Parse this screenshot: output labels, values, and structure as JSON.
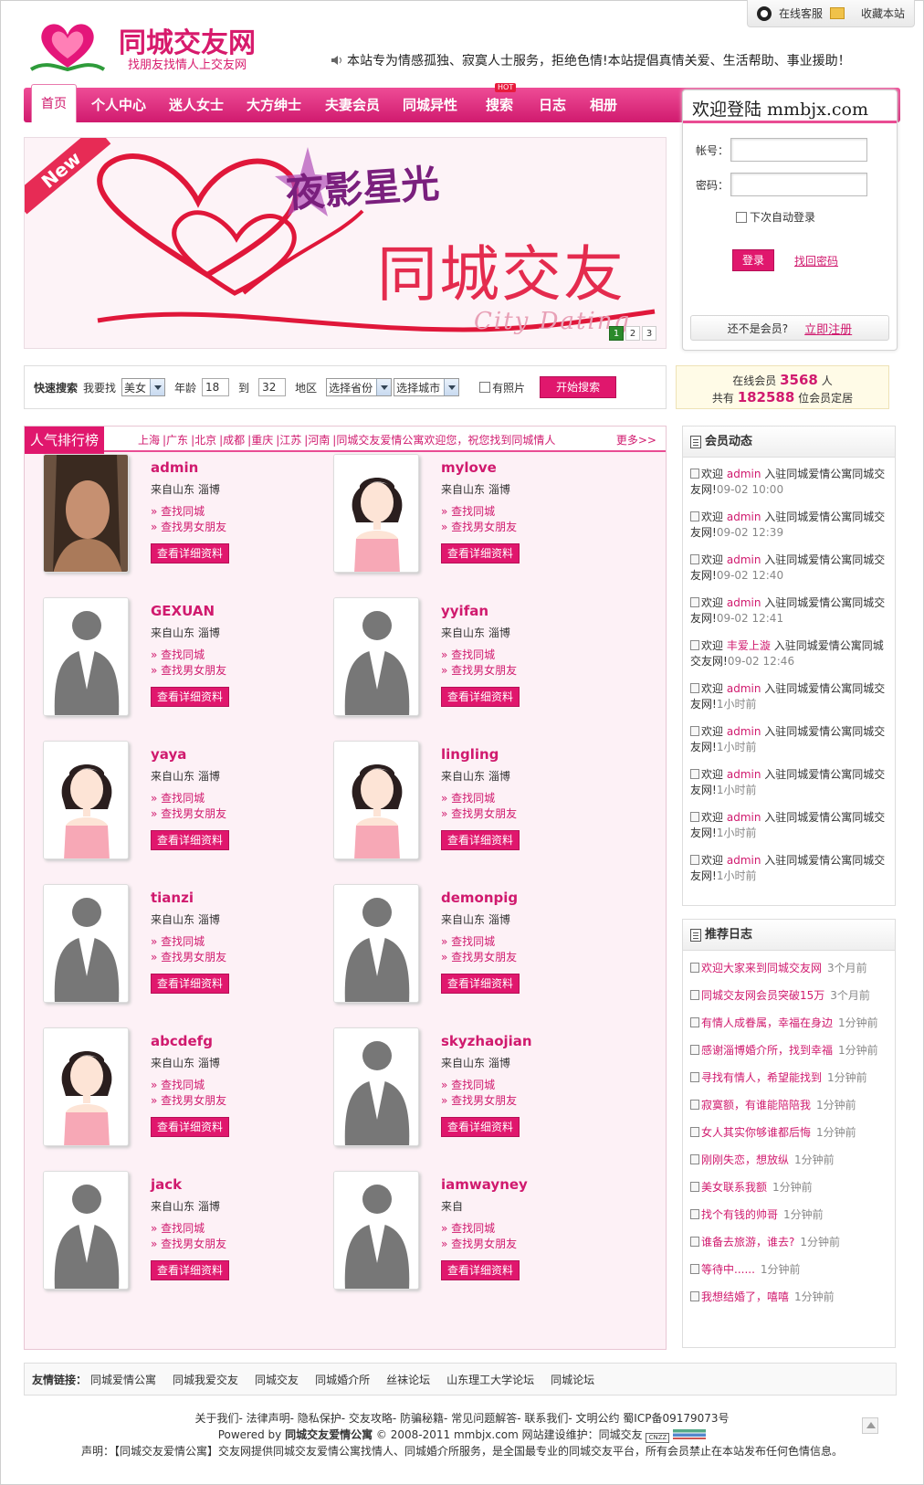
{
  "topbar": {
    "service": "在线客服",
    "bookmark": "收藏本站"
  },
  "logo": {
    "title": "同城交友网",
    "subtitle": "找朋友找情人上交友网"
  },
  "notice": "本站专为情感孤独、寂寞人士服务，拒绝色情!本站提倡真情关爱、生活帮助、事业援助！",
  "nav": {
    "items": [
      "首页",
      "个人中心",
      "迷人女士",
      "大方绅士",
      "夫妻会员",
      "同城异性",
      "搜索",
      "日志",
      "相册"
    ],
    "hot_badge": "HOT"
  },
  "banner": {
    "new_tag": "New",
    "title": "同城交友",
    "subtitle": "夜影星光",
    "english": "City Dating",
    "pages": [
      "1",
      "2",
      "3"
    ]
  },
  "login": {
    "heading": "欢迎登陆 mmbjx.com",
    "account_label": "帐号：",
    "password_label": "密码：",
    "auto_login": "下次自动登录",
    "login_button": "登录",
    "forgot_link": "找回密码",
    "not_member": "还不是会员?",
    "register_link": "立即注册"
  },
  "search": {
    "title": "快速搜索",
    "seek_label": "我要找",
    "gender": "美女",
    "age_label": "年龄",
    "age_from": "18",
    "to_label": "到",
    "age_to": "32",
    "region_label": "地区",
    "province": "选择省份",
    "city": "选择城市",
    "has_photo": "有照片",
    "button": "开始搜索"
  },
  "stats": {
    "online_prefix": "在线会员",
    "online_count": "3568",
    "online_suffix": "人",
    "total_prefix": "共有",
    "total_count": "182588",
    "total_suffix": "位会员定居"
  },
  "popular": {
    "title": "人气排行榜",
    "cities": [
      "上海",
      "|广东",
      "|北京",
      "|成都",
      "|重庆",
      "|江苏",
      "|河南",
      "|同城交友爱情公寓欢迎您，祝您找到同城情人"
    ],
    "more": "更多>>",
    "link1": "查找同城",
    "link2": "查找男女朋友",
    "detail_button": "查看详细资料",
    "members": [
      {
        "name": "admin",
        "from": "来自山东  淄博",
        "photo": "photo"
      },
      {
        "name": "mylove",
        "from": "来自山东  淄博",
        "photo": "cartoon"
      },
      {
        "name": "GEXUAN",
        "from": "来自山东  淄博",
        "photo": "silhouette"
      },
      {
        "name": "yyifan",
        "from": "来自山东  淄博",
        "photo": "silhouette"
      },
      {
        "name": "yaya",
        "from": "来自山东  淄博",
        "photo": "cartoon"
      },
      {
        "name": "lingling",
        "from": "来自山东  淄博",
        "photo": "cartoon"
      },
      {
        "name": "tianzi",
        "from": "来自山东  淄博",
        "photo": "silhouette"
      },
      {
        "name": "demonpig",
        "from": "来自山东  淄博",
        "photo": "silhouette"
      },
      {
        "name": "abcdefg",
        "from": "来自山东  淄博",
        "photo": "cartoon"
      },
      {
        "name": "skyzhaojian",
        "from": "来自山东  淄博",
        "photo": "silhouette"
      },
      {
        "name": "jack",
        "from": "来自山东  淄博",
        "photo": "silhouette"
      },
      {
        "name": "iamwayney",
        "from": "来自",
        "photo": "silhouette"
      }
    ]
  },
  "activity": {
    "title": "会员动态",
    "items": [
      {
        "pre": "欢迎",
        "user": "admin",
        "post": "入驻同城爱情公寓同城交友网!",
        "time": "09-02 10:00"
      },
      {
        "pre": "欢迎",
        "user": "admin",
        "post": "入驻同城爱情公寓同城交友网!",
        "time": "09-02 12:39"
      },
      {
        "pre": "欢迎",
        "user": "admin",
        "post": "入驻同城爱情公寓同城交友网!",
        "time": "09-02 12:40"
      },
      {
        "pre": "欢迎",
        "user": "admin",
        "post": "入驻同城爱情公寓同城交友网!",
        "time": "09-02 12:41"
      },
      {
        "pre": "欢迎",
        "user": "丰爱上漩",
        "post": "入驻同城爱情公寓同城交友网!",
        "time": "09-02 12:46"
      },
      {
        "pre": "欢迎",
        "user": "admin",
        "post": "入驻同城爱情公寓同城交友网!",
        "time": "1小时前"
      },
      {
        "pre": "欢迎",
        "user": "admin",
        "post": "入驻同城爱情公寓同城交友网!",
        "time": "1小时前"
      },
      {
        "pre": "欢迎",
        "user": "admin",
        "post": "入驻同城爱情公寓同城交友网!",
        "time": "1小时前"
      },
      {
        "pre": "欢迎",
        "user": "admin",
        "post": "入驻同城爱情公寓同城交友网!",
        "time": "1小时前"
      },
      {
        "pre": "欢迎",
        "user": "admin",
        "post": "入驻同城爱情公寓同城交友网!",
        "time": "1小时前"
      }
    ]
  },
  "blogs": {
    "title": "推荐日志",
    "items": [
      {
        "title": "欢迎大家来到同城交友网",
        "time": "3个月前"
      },
      {
        "title": "同城交友网会员突破15万",
        "time": "3个月前"
      },
      {
        "title": "有情人成眷属，幸福在身边",
        "time": "1分钟前"
      },
      {
        "title": "感谢淄博婚介所，找到幸福",
        "time": "1分钟前"
      },
      {
        "title": "寻找有情人，希望能找到",
        "time": "1分钟前"
      },
      {
        "title": "寂寞额，有谁能陪陪我",
        "time": "1分钟前"
      },
      {
        "title": "女人其实你够谁都后悔",
        "time": "1分钟前"
      },
      {
        "title": "刚刚失恋，想放纵",
        "time": "1分钟前"
      },
      {
        "title": "美女联系我额",
        "time": "1分钟前"
      },
      {
        "title": "找个有钱的帅哥",
        "time": "1分钟前"
      },
      {
        "title": "谁备去旅游，谁去?",
        "time": "1分钟前"
      },
      {
        "title": "等待中......",
        "time": "1分钟前"
      },
      {
        "title": "我想结婚了，嘻嘻",
        "time": "1分钟前"
      }
    ]
  },
  "friend_links": {
    "label": "友情链接：",
    "items": [
      "同城爱情公寓",
      "同城我爱交友",
      "同城交友",
      "同城婚介所",
      "丝袜论坛",
      "山东理工大学论坛",
      "同城论坛"
    ]
  },
  "footer": {
    "line1": "关于我们- 法律声明- 隐私保护- 交友攻略- 防骗秘籍- 常见问题解答- 联系我们- 文明公约  蜀ICP备09179073号",
    "powered_prefix": "Powered by",
    "powered_brand": "同城交友爱情公寓",
    "powered_suffix": "© 2008-2011 mmbjx.com 网站建设维护：同城交友",
    "cnzz": "CNZZ",
    "statement": "声明：【同城交友爱情公寓】交友网提供同城交友爱情公寓找情人、同城婚介所服务，是全国最专业的同城交友平台，所有会员禁止在本站发布任何色情信息。"
  },
  "colors": {
    "accent": "#e0176d",
    "nav_top": "#ee4c96",
    "nav_bottom": "#d01a6e",
    "popular_bg": "#fdf1f6"
  }
}
